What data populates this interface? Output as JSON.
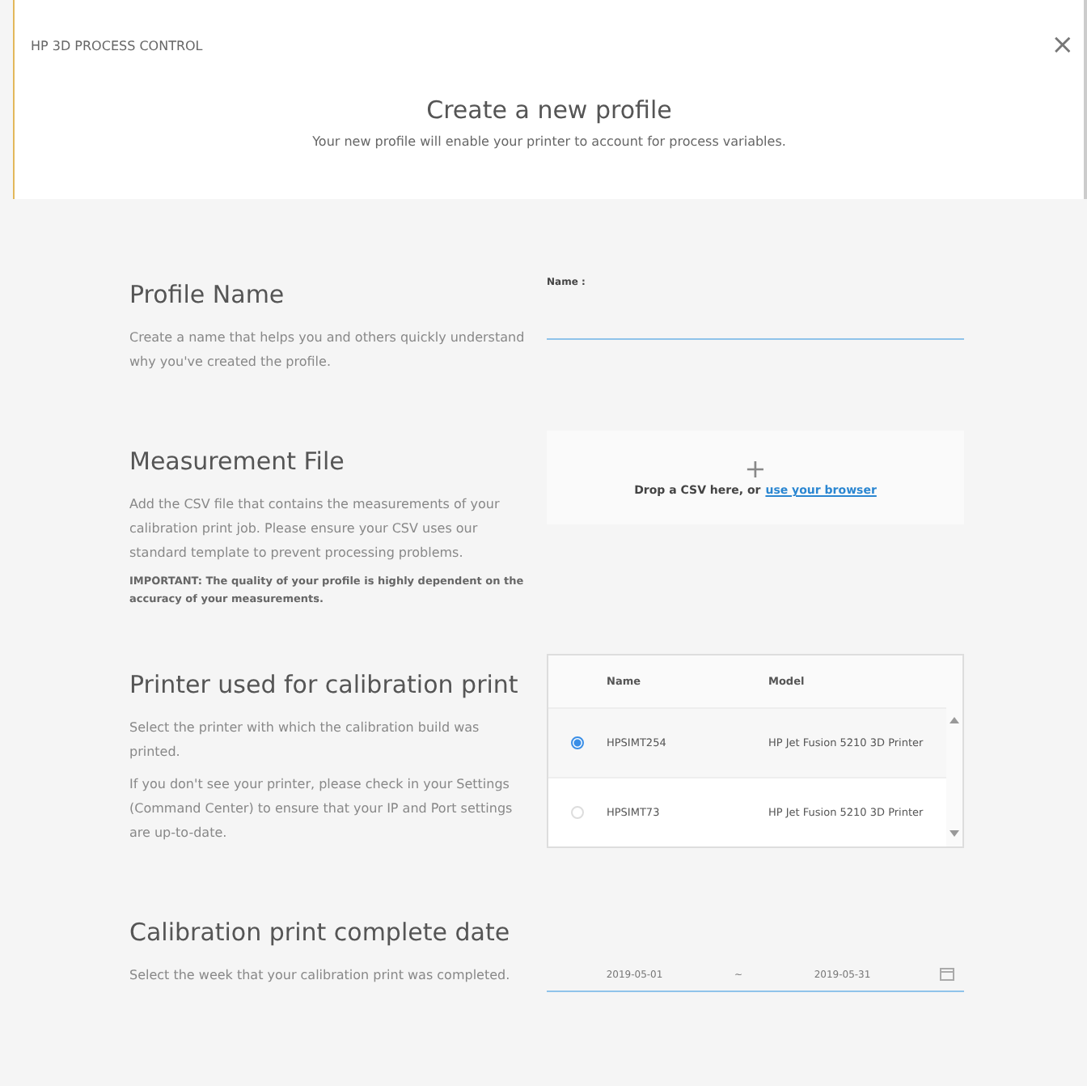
{
  "app_title": "HP 3D PROCESS CONTROL",
  "close": "×",
  "header": {
    "title": "Create a new profile",
    "subtitle": "Your new profile will enable your printer to account for process variables."
  },
  "profile_name": {
    "heading": "Profile Name",
    "description": "Create a name that helps you and others quickly understand why you've created the profile.",
    "field_label": "Name :"
  },
  "measurement_file": {
    "heading": "Measurement File",
    "description": "Add the CSV file that contains the measurements of your calibration print job. Please ensure your CSV uses our standard template to prevent processing problems.",
    "note": "IMPORTANT: The quality of your profile is highly dependent on the accuracy of your measurements.",
    "plus": "+",
    "drop_text": "Drop a CSV here, or",
    "link": "use your browser"
  },
  "printer": {
    "heading": "Printer used for calibration print",
    "descriptions": [
      "Select the printer with which the calibration build was printed.",
      "If you don't see your printer, please check in your Settings (Command Center) to ensure that your IP and Port settings are up-to-date."
    ],
    "columns": [
      "Name",
      "Model"
    ],
    "rows": [
      {
        "name": "HPSIMT254",
        "model": "HP Jet Fusion 5210 3D Printer",
        "selected": true
      },
      {
        "name": "HPSIMT73",
        "model": "HP Jet Fusion 5210 3D Printer",
        "selected": false
      }
    ]
  },
  "date": {
    "heading": "Calibration print complete date",
    "description": "Select the week that your calibration print was completed.",
    "start": "2019-05-01",
    "separator": "~",
    "end": "2019-05-31"
  }
}
